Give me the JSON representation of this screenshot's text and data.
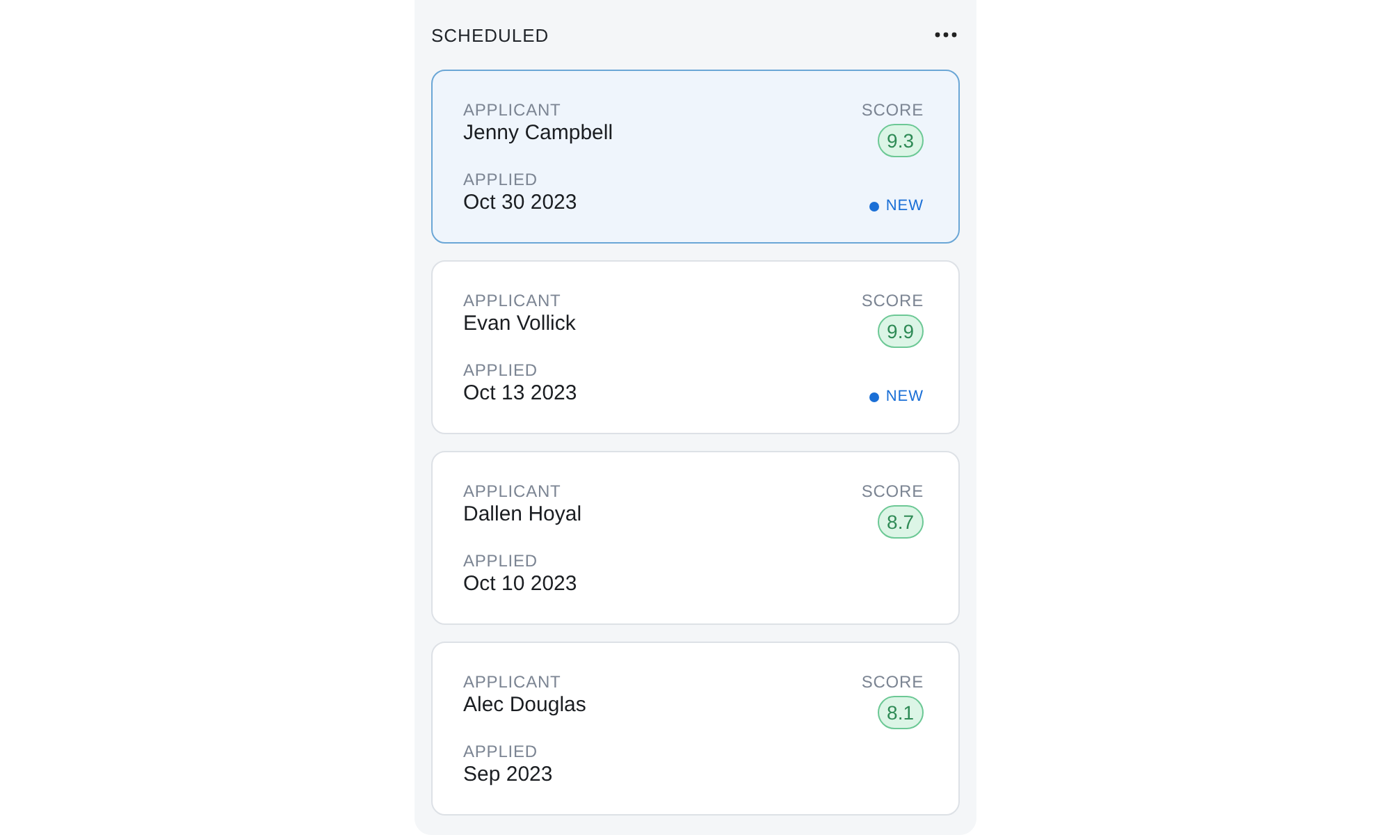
{
  "column": {
    "title": "SCHEDULED"
  },
  "cards": [
    {
      "applicant_label": "APPLICANT",
      "applicant": "Jenny Campbell",
      "applied_label": "APPLIED",
      "applied": "Oct 30 2023",
      "score_label": "SCORE",
      "score": "9.3",
      "new": true,
      "new_label": "NEW",
      "selected": true
    },
    {
      "applicant_label": "APPLICANT",
      "applicant": "Evan Vollick",
      "applied_label": "APPLIED",
      "applied": "Oct 13 2023",
      "score_label": "SCORE",
      "score": "9.9",
      "new": true,
      "new_label": "NEW",
      "selected": false
    },
    {
      "applicant_label": "APPLICANT",
      "applicant": "Dallen Hoyal",
      "applied_label": "APPLIED",
      "applied": "Oct 10 2023",
      "score_label": "SCORE",
      "score": "8.7",
      "new": false,
      "selected": false
    },
    {
      "applicant_label": "APPLICANT",
      "applicant": "Alec Douglas",
      "applied_label": "APPLIED",
      "applied": "Sep 2023",
      "score_label": "SCORE",
      "score": "8.1",
      "new": false,
      "selected": false
    }
  ]
}
